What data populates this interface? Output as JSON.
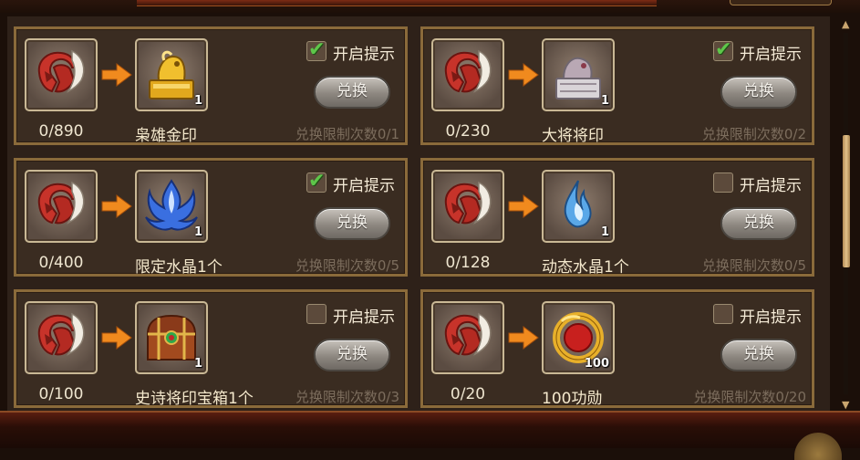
{
  "exchange_items": [
    {
      "count": "0/890",
      "reward_name": "枭雄金印",
      "reward_qty": "1",
      "reminder_label": "开启提示",
      "reminder_checked": true,
      "button_label": "兑换",
      "limit_text": "兑换限制次数0/1",
      "reward_icon": "gold-seal-icon"
    },
    {
      "count": "0/230",
      "reward_name": "大将将印",
      "reward_qty": "1",
      "reminder_label": "开启提示",
      "reminder_checked": true,
      "button_label": "兑换",
      "limit_text": "兑换限制次数0/2",
      "reward_icon": "silver-seal-icon"
    },
    {
      "count": "0/400",
      "reward_name": "限定水晶1个",
      "reward_qty": "1",
      "reminder_label": "开启提示",
      "reminder_checked": true,
      "button_label": "兑换",
      "limit_text": "兑换限制次数0/5",
      "reward_icon": "blue-crystal-icon"
    },
    {
      "count": "0/128",
      "reward_name": "动态水晶1个",
      "reward_qty": "1",
      "reminder_label": "开启提示",
      "reminder_checked": false,
      "button_label": "兑换",
      "limit_text": "兑换限制次数0/5",
      "reward_icon": "crystal-flame-icon"
    },
    {
      "count": "0/100",
      "reward_name": "史诗将印宝箱1个",
      "reward_qty": "1",
      "reminder_label": "开启提示",
      "reminder_checked": false,
      "button_label": "兑换",
      "limit_text": "兑换限制次数0/3",
      "reward_icon": "treasure-chest-icon"
    },
    {
      "count": "0/20",
      "reward_name": "100功勋",
      "reward_qty": "100",
      "reminder_label": "开启提示",
      "reminder_checked": false,
      "button_label": "兑换",
      "limit_text": "兑换限制次数0/20",
      "reward_icon": "merit-medal-icon"
    }
  ],
  "source_icon": "red-helmet-token-icon",
  "colors": {
    "panel": "#3a2c21",
    "border": "#8a6a3a",
    "check": "#5ec64a",
    "arrow": "#f08a1e"
  }
}
